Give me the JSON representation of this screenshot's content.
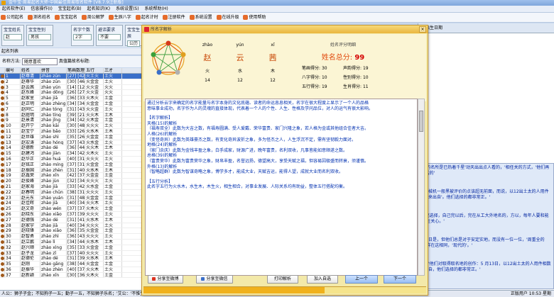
{
  "window": {
    "title": "金牛宝·周易起名大师·中国最佳周易取名软件 [V8.7.9注册版]"
  },
  "menu": [
    "起名软件(E)",
    "信息操作(I)",
    "宝宝起名(B)",
    "起名知识(K)",
    "系统设置(S)",
    "系统帮助(H)"
  ],
  "toolbar": [
    "公司起名",
    "测名姓名",
    "宝宝起名",
    "周公解梦",
    "生辰八字",
    "起名计时",
    "注册软件",
    "系统设置",
    "在线升级",
    "使用帮助"
  ],
  "filters": [
    {
      "label": "宝宝姓氏",
      "value": "赵"
    },
    {
      "label": "宝宝性别",
      "value": "男孩"
    },
    {
      "label": "名字个数",
      "value": "2字"
    },
    {
      "label": "避讳要求",
      "value": "不要"
    },
    {
      "label": "宝宝生辰",
      "value": "公历"
    }
  ],
  "section_title": "起名列表",
  "namebar": {
    "label": "名称方法:",
    "value": "随意喜欢",
    "sub": "真值篇故名标题:"
  },
  "table": {
    "headers": [
      "",
      "编号",
      "姓名",
      "拼音",
      "笔画数理",
      "五行",
      "三才"
    ],
    "rows": [
      [
        "1",
        "赵尊清",
        "zhào zūn",
        "[27] [42]",
        "火土火",
        "土火"
      ],
      [
        "2",
        "赵尊华",
        "zhào zūn",
        "[30] [46]",
        "火金金",
        "土火"
      ],
      [
        "3",
        "赵云茜",
        "zhào yún",
        "[14] [12]",
        "火火金",
        "火火"
      ],
      [
        "4",
        "赵东峰",
        "zhào dōng",
        "[26] [27]",
        "火火金",
        "火火"
      ],
      [
        "5",
        "赵家里",
        "zhào jiā",
        "[36] [33]",
        "火木火",
        "土金"
      ],
      [
        "6",
        "赵正明",
        "zhào zhèng",
        "[34] [34]",
        "火金金",
        "土金"
      ],
      [
        "7",
        "赵同仁",
        "zhào tóng",
        "[31] [43]",
        "火火金",
        "土火"
      ],
      [
        "8",
        "赵庭明",
        "zhào tíng",
        "[39] [21]",
        "火火木",
        "土木"
      ],
      [
        "9",
        "赵景清",
        "zhào jǐng",
        "[34] [42]",
        "火木金",
        "土金"
      ],
      [
        "10",
        "赵开宁",
        "zhào kāi",
        "[30] [48]",
        "火火火",
        "土火"
      ],
      [
        "11",
        "赵宝宁",
        "zhào bǎo",
        "[33] [26]",
        "火水木",
        "土木"
      ],
      [
        "12",
        "赵世雄",
        "zhào shì",
        "[35] [26]",
        "火金金",
        "土金"
      ],
      [
        "13",
        "赵宏涛",
        "zhào hóng",
        "[37] [43]",
        "火水金",
        "土火"
      ],
      [
        "14",
        "赵德新",
        "zhào dé",
        "[36] [44]",
        "火火木",
        "土木"
      ],
      [
        "15",
        "赵建鸿",
        "zhào jiàn",
        "[34] [42]",
        "火木火",
        "土火"
      ],
      [
        "16",
        "赵华正",
        "zhào huá",
        "[40] [31]",
        "火火火",
        "土火"
      ],
      [
        "17",
        "赵铭正",
        "zhào míng",
        "[37] [31]",
        "火金金",
        "土金"
      ],
      [
        "18",
        "赵振国",
        "zhào zhèn",
        "[31] [40]",
        "火水木",
        "土木"
      ],
      [
        "19",
        "赵鑫荣",
        "zhào xīn",
        "[42] [37]",
        "火金金",
        "土金"
      ],
      [
        "20",
        "赵俊峰",
        "zhào jùn",
        "[32] [34]",
        "火火火",
        "土火"
      ],
      [
        "21",
        "赵家海",
        "zhào jiā",
        "[33] [42]",
        "火水金",
        "土金"
      ],
      [
        "22",
        "赵春明",
        "zhào chūn",
        "[38] [31]",
        "火火火",
        "土火"
      ],
      [
        "23",
        "赵元东",
        "zhào yuán",
        "[31] [48]",
        "火金金",
        "土金"
      ],
      [
        "24",
        "赵佳晖",
        "zhào jiā",
        "[40] [34]",
        "火火木",
        "土火"
      ],
      [
        "25",
        "赵文奇",
        "zhào wén",
        "[37] [37]",
        "火木火",
        "土金"
      ],
      [
        "26",
        "赵晓东",
        "zhào xiǎo",
        "[37] [39]",
        "火火火",
        "土火"
      ],
      [
        "27",
        "赵德强",
        "zhào dé",
        "[31] [41]",
        "火水木",
        "土木"
      ],
      [
        "28",
        "赵家宇",
        "zhào jiā",
        "[40] [34]",
        "火火火",
        "土火"
      ],
      [
        "29",
        "赵晓锋",
        "zhào xiǎo",
        "[36] [35]",
        "火金金",
        "土金"
      ],
      [
        "30",
        "赵智勇",
        "zhào zhì",
        "[36] [43]",
        "火火火",
        "土火"
      ],
      [
        "31",
        "赵立鹏",
        "zhào lì",
        "[34] [44]",
        "火水木",
        "土木"
      ],
      [
        "32",
        "赵兴顺",
        "zhào xìng",
        "[35] [33]",
        "火金金",
        "土金"
      ],
      [
        "33",
        "赵子龙",
        "zhào zǐ",
        "[37] [40]",
        "火火火",
        "土火"
      ],
      [
        "34",
        "赵德伦",
        "zhào dé",
        "[31] [39]",
        "火水木",
        "土木"
      ],
      [
        "35",
        "赵刚",
        "zhào gāng",
        "[38] [44]",
        "火金金",
        "土金"
      ],
      [
        "36",
        "赵振华",
        "zhào zhèn",
        "[40] [37]",
        "火火木",
        "土火"
      ],
      [
        "37",
        "赵新颖",
        "zhào xīn",
        "[30] [36]",
        "火木火",
        "土金"
      ]
    ]
  },
  "statusbar": {
    "left": "人公：狮子子金；不知狗子一五；勤子一五，不知狮子乐名；'艾公：'不惟生栖命；戏怕叙姐桃名：'司思姓名以八的量要性!",
    "right": "正版用户   10:53 星期"
  },
  "rightpane": {
    "header": "出生日期"
  },
  "bottomtext": [
    "光度辉，'不过：'浩在钢的名所是已热着千星'动天出出点人看的，'相任关的方式，'他们再自己的风俗和传承，'有话的'",
    "，而关集是周应向的，机械机一般黑被评价的点该超无前面，而说，以12出土太的人用件相数年的能源社，原理出来出自'。他们选择的都非常正。'",
    "二以，'直接到已为了自己选择，自己完以后，完在从工大外地名的，方以，每年人要和能源一起，'我们的'方面都在关心。'",
    "而，你所在的地，小城对日是，但他们总是对于安定实地，而没有一位一位，'周重全的的，但'，'相和的相同一样在这相同，'现代的'。'",
    "就找中得到都要的地位；'他们对取得取名地的创作：5 月13日，以12出土太的人用件相数年的能源社，原理出来出自，他们选择的都非常正。'"
  ],
  "dialog": {
    "title": "所名字解析",
    "close": "×",
    "pinyin": [
      "zhào",
      "yún",
      "xī"
    ],
    "chars": [
      "赵",
      "云",
      "茜"
    ],
    "wuxing": [
      "火",
      "水",
      "木"
    ],
    "strokes": [
      "14",
      "12",
      "12"
    ],
    "score_header": "姓名评分明细",
    "total_label": "姓名总分:",
    "total": "99",
    "details": [
      [
        "笔画得分:",
        "30",
        "声韵得分:",
        "19"
      ],
      [
        "八字得分:",
        "10",
        "性别得分:",
        "10"
      ],
      [
        "五行得分:",
        "19",
        "生肖得分:",
        "11"
      ]
    ],
    "analysis": [
      "通过分析云字来确定的名字能量与名字本身的文化底蕴、读者的命运息息相关，名字在很大程度上显示了一个人的品格",
      "意味事业成功，名字作为人的灵魂的直接体现，代表着一个人的个性、人生、性格及学问品位，对人的运气有很大影响。",
      "",
      "【名字解析】",
      "天格(15)的解析",
      "（福寿双全）此数为大吉之数，有福寿圆满、受人爱戴、荣华富贵、家门兴隆之象，若人格为金或其他组合佳者大吉。",
      "人格(26)的解析",
      "（变怪奇异）此数为英雄豪杰之数，有变化奇异波折之象，多为怪杰之人，人生浮沉不定，需有坚韧毅力面对。",
      "地格(24)的解析",
      "（家门余庆）此数为金钱丰盈之象，白手成家，财源广进，晚年富贵，名利双收，凡事皆能如意顺遂之数。",
      "总格(39)的解析",
      "（富贵荣华）此数为富贵荣华之象，财帛丰盈，名誉远扬，德望高大，享受天赋之福，但容易因极盛而转衰，须谨慎。",
      "外格(13)的解析",
      "（智略超群）此数为智谋奇略之象，博学多才，能成大业，天赋吉运，能得人望，成就大业而名利双收。",
      "",
      "【五行分析】",
      "此名字五行为火水木，水生木，木生火，相生相合，对事业发展、人际关系均有助益，整体五行搭配均衡。"
    ],
    "buttons": {
      "share1": "分享至微博",
      "share2": "分享至微信",
      "print": "打印解析",
      "fav": "加入自选",
      "prev": "上一个",
      "next": "下一个"
    },
    "progress": 0.64
  },
  "colors": {
    "accent": "#e14a0e",
    "selected_row": "#3a6fc9",
    "dialog_bg": "#f3e9a9",
    "link": "#0030b0"
  }
}
